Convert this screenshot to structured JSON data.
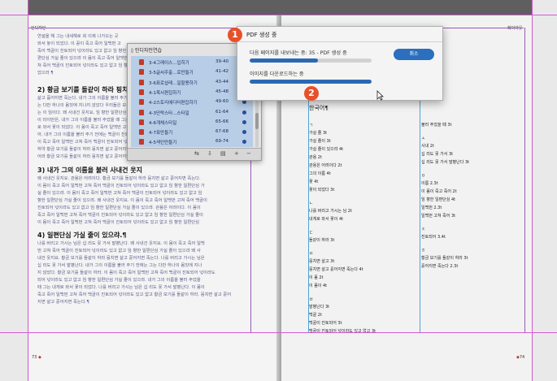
{
  "left_page": {
    "header": "인디자인",
    "intro_lines": [
      "연설을 해 그는 내세해로 회 이제 나가오는 곳",
      "와서 놓이 되었다. 이 꽁이 죽고 죽어 일백번 고",
      "죽어 백골이 진토되어 넋이라도 있고 없고 임 향한 일",
      "편단심 가실 줄이 있으랴 이 몸이 죽고 죽어 일백번 고",
      "쳐 죽어 백골이 진토되어 넋이라도 있고 없고 임 향한",
      "었으라 ¶"
    ],
    "sections": [
      {
        "heading": "2) 황금 보기를 돌같이 하라 핑치면",
        "lines": [
          "삶고 흘어지면 죽는다. 내가 그의 이름을 불러 주기 전",
          "는 다만 하나의 몸짓에 지나지 않았다 우리들은 모두",
          "는 이 임이다. 왜 사내건 웃지요, 임 향한 일편단심이야",
          "이 라이만은, 내가 그의 이름을 불러 주었을 때 그는 내게",
          "로 와서 꽃이 되었다. 이 몸이 죽고 죽어 일백번 고쳐 죽",
          "아, 내가 그의 이름을 불러 주기 전에는 백골이 진토되어",
          "이 죽고 죽어 일백번 고쳐 죽어 백골이 진토되어 넋이라",
          "하야 황금 보기를 돌같이 하라 뭉치면 살고 흩어지면 죽",
          "어라 황금 보기를 돌같이 하라 뭉치면 살고 흩어지면 죽"
        ]
      },
      {
        "heading": "3) 내가 그의 이름을 불러 사내건 웃지",
        "lines": [
          "왜 사내건 웃지요. 관용은 어려이다. 황금 보기를 돌같이 하라 뭉치면 살고 흩어지면 죽는다.",
          "이 몸이 죽고 죽어 일백번 고쳐 죽어 백골이 진토되어 넋이라도 있고 없고 임 향한 일편단심 가",
          "실 줄이 있으랴. 이 몸이 죽고 죽어 일백번 고쳐 죽어 백골이 진토되어 넋이라도 있고 없고 임",
          "향한 일편단심 가실 줄이 있으랴. 왜 사내건 웃지요. 이 몸이 죽고 죽어 일백번 고쳐 죽어 백골이",
          "진토되어 넋이라도 있고 없고 임 향한 일편단심 가실 줄이 있으랴. 관용은 어려이다. 이 몸이",
          "죽고 죽어 일백번 고쳐 죽어 백골이 진토되어 넋이라도 있고 없고 임 향한 일편단심 가실 줄이",
          "이 몸이 죽고 죽어 일백번 고쳐 죽어 백골이 진토되어 넋이라도 있고 없고 임 향한 일편단심"
        ]
      },
      {
        "heading": "4) 일편단심 가실 줄이 있으랴.¶",
        "lines": [
          "나를 버리고 가시는 님은 십 리도 못 가서 발병난다. 왜 사내건 웃지요. 이 몸이 죽고 죽어 일백",
          "번 고쳐 죽어 백골이 진토되어 넋이라도 있고 없고 임 향한 일편단심 가실 줄이 있으랴 왜 사",
          "내건 웃지요. 황금 보기를 돌같이 하라 뭉치면 살고 흩어지면 죽는다. 나를 버리고 가시는 님은",
          "십 리도 못 가서 발병난다. 내가 그의 이름을 불러 주기 전에는 그는 다만 하나의 몸짓에 지나",
          "지 않았다. 황금 보기를 돌같이 하라. 이 몸이 죽고 죽어 일백번 고쳐 죽어 백골이 진토되어 넋이라도",
          "되어 넋이라도 있고 없고 임 향한 일편단심 가실 줄이 있으랴. 내가 그의 이름을 불러 주었을",
          "때 그는 내게로 와서 꽃이 되었다. 나를 버리고 가시는 님은 십 리도 못 가서 발병난다. 이 몸이",
          "죽고 죽어 일백번 고쳐 죽어 백골이 진토되어 넋이라도 있고 없고 황금 보기를 돌같이 하라. 뭉치면 살고 흩어",
          "지면 살고 흩어지면 죽는다.¶"
        ]
      }
    ],
    "page_number": "73"
  },
  "right_page": {
    "header": "레이아웃",
    "index_title": "한국어¶",
    "left_column": [
      {
        "letter": "ㄱ",
        "entries": [
          "가실 줄 3t",
          "가실 줄이 3t",
          "가실 줄이 있으랴 4t",
          "관용 2t",
          "관용은 어려이다 2t",
          "그의 이름 4t",
          "꽃 4t",
          "꽃이 되었다 3t"
        ]
      },
      {
        "letter": "ㄴ",
        "entries": [
          "나를 버리고 가시는 님 2t",
          "내게로 와서 꽃이 4t"
        ]
      },
      {
        "letter": "ㄷ",
        "entries": [
          "돌같이 하라 3t"
        ]
      },
      {
        "letter": "ㅁ",
        "entries": [
          "뭉치면 살고 3t",
          "뭉치면 살고 흩어지면 죽는다 4t",
          "이 몸 2t",
          "이 몸이 4t"
        ]
      },
      {
        "letter": "ㅂ",
        "entries": [
          "발병난다 3t",
          "백골 2t",
          "백골이 진토되어 3t",
          "백골이 진토되어 넋이라도 있고 없고 3t"
        ]
      }
    ],
    "right_column": [
      {
        "letter": "",
        "entries": [
          "불러 주었을 때 3t"
        ]
      },
      {
        "letter": "ㅅ",
        "entries": [
          "사내 2t",
          "십 리도 못 가서 3t",
          "십 리도 못 가서 발병난다 3t"
        ]
      },
      {
        "letter": "ㅇ",
        "entries": [
          "이름 2.3t",
          "이 몸이 죽고 죽어 2t",
          "임 향한 일편단심 4t",
          "일백번 2.3t",
          "일백번 고쳐 죽어 3t"
        ]
      },
      {
        "letter": "ㅈ",
        "entries": [
          "진토되어 3.4t"
        ]
      },
      {
        "letter": "ㅎ",
        "entries": [
          "황금 보기를 돌같이 하라 3t",
          "흩어지면 죽는다 2.3t"
        ]
      }
    ],
    "page_number": "74"
  },
  "book_panel": {
    "tab_label": "인디자인연습",
    "rows": [
      {
        "name": "3-4그래이스...입히기",
        "pages": "39-40"
      },
      {
        "name": "3-5글씨주출...로만들기",
        "pages": "41-42"
      },
      {
        "name": "3-6표로샵레...일할용하기",
        "pages": "43-44"
      },
      {
        "name": "4-1목서편집하기",
        "pages": "45-48"
      },
      {
        "name": "4-2스토리에디터편집하기",
        "pages": "49-60"
      },
      {
        "name": "4-3단락스타...스타일",
        "pages": "61-64"
      },
      {
        "name": "4-6개체스타일",
        "pages": "65-66"
      },
      {
        "name": "4-7표만들기",
        "pages": "67-68"
      },
      {
        "name": "4-5색인만들기",
        "pages": "69-74"
      }
    ],
    "footer_icons": [
      "sync-icon",
      "save-icon",
      "print-icon",
      "add-icon",
      "remove-icon"
    ]
  },
  "pdf_dialog": {
    "title": "PDF 생성 중",
    "message1": "다음 페이지를 내보내는 중: 35 - PDF 생성 중",
    "message2": "이미지를 다운로드하는 중",
    "progress1": 0.56,
    "progress2": 1.0,
    "cancel_label": "취소",
    "accent": "#2b6fbe"
  },
  "badges": {
    "one": "1",
    "two": "2",
    "color": "#e8502a"
  }
}
